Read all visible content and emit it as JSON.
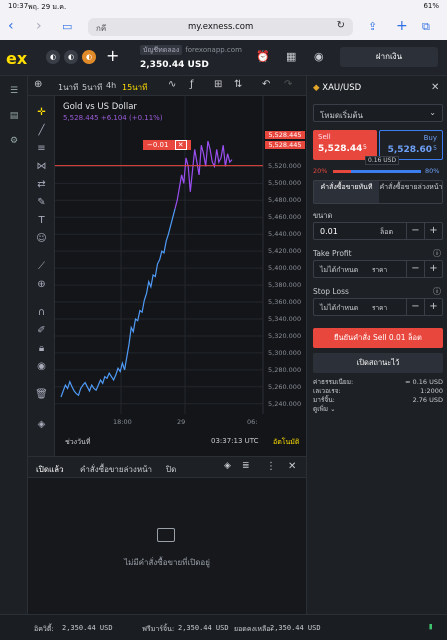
{
  "ios": {
    "time": "10:37",
    "date": "พฤ. 29 ม.ค.",
    "battery": "61%"
  },
  "safari": {
    "tab_text": "กคี",
    "url": "my.exness.com"
  },
  "header": {
    "logo": "ex",
    "account_badge": "บัญชีทดลอง",
    "server": "forexonapp.com",
    "balance": "2,350.44 USD",
    "deposit_label": "ฝากเงิน"
  },
  "toolbar": {
    "timeframes": [
      "1นาที",
      "5นาที",
      "4h",
      "15นาที"
    ],
    "active_timeframe": "15นาที"
  },
  "chart": {
    "title": "Gold vs US Dollar",
    "subtitle": "5,528.445  +6.104 (+0.11%)",
    "sell_line_label": "−0.01",
    "price_tags": [
      "5,528.445",
      "5,528.445"
    ],
    "footer_left": "ช่วงวันที่",
    "footer_time": "03:37:13 UTC",
    "footer_auto": "อัตโนมัติ"
  },
  "chart_data": {
    "type": "line",
    "title": "Gold vs US Dollar",
    "x_ticks": [
      "18:00",
      "29",
      "06:"
    ],
    "y_ticks": [
      5240,
      5260,
      5280,
      5300,
      5320,
      5340,
      5360,
      5380,
      5400,
      5420,
      5440,
      5460,
      5480,
      5500,
      5520
    ],
    "ylim": [
      5235,
      5570
    ],
    "series": [
      {
        "color": "#4f9bf7",
        "x": [
          0,
          2,
          4,
          6,
          8,
          10,
          12,
          14,
          16,
          18,
          20,
          22,
          24,
          26,
          28,
          30,
          32,
          34,
          36,
          38,
          40,
          42,
          44,
          46,
          48,
          50,
          52,
          54,
          56,
          58,
          60,
          62,
          64,
          66,
          68,
          70,
          72,
          74,
          76,
          78,
          80,
          82,
          84,
          86,
          88,
          90,
          92,
          94,
          96,
          98,
          100,
          102,
          104
        ],
        "y": [
          5248,
          5255,
          5262,
          5258,
          5266,
          5260,
          5255,
          5252,
          5250,
          5258,
          5262,
          5265,
          5260,
          5255,
          5262,
          5258,
          5256,
          5262,
          5268,
          5264,
          5272,
          5270,
          5276,
          5272,
          5268,
          5274,
          5282,
          5278,
          5288,
          5280,
          5295,
          5310,
          5330,
          5325,
          5340,
          5338,
          5350,
          5348,
          5362,
          5370,
          5384,
          5378,
          5392,
          5390,
          5405,
          5410,
          5420,
          5418,
          5432,
          5440,
          5450,
          5460,
          5470
        ]
      },
      {
        "color": "#9b4ff2",
        "x": [
          104,
          106,
          108,
          110,
          112,
          114,
          116,
          118,
          120,
          122,
          124,
          126,
          128,
          130,
          132,
          134,
          136,
          138,
          140,
          142,
          144,
          146,
          148,
          150,
          152,
          154,
          156
        ],
        "y": [
          5470,
          5480,
          5495,
          5510,
          5500,
          5530,
          5520,
          5490,
          5515,
          5540,
          5525,
          5510,
          5545,
          5535,
          5520,
          5550,
          5540,
          5525,
          5520,
          5540,
          5525,
          5530,
          5545,
          5520,
          5535,
          5525,
          5528
        ]
      }
    ]
  },
  "order": {
    "symbol": "XAU/USD",
    "mode": "โหมดเริ่มต้น",
    "sell_label": "Sell",
    "sell_price": "5,528.44",
    "sell_suffix": "5",
    "buy_label": "Buy",
    "buy_price": "5,528.60",
    "buy_suffix": "5",
    "spread": "0.16 USD",
    "sentiment_sell": "20%",
    "sentiment_buy": "80%",
    "tab_market": "คำสั่งซื้อขายทันที",
    "tab_pending": "คำสั่งซื้อขายล่วงหน้า",
    "volume_label": "ขนาด",
    "volume_value": "0.01",
    "volume_unit": "ล็อต",
    "tp_label": "Take Profit",
    "tp_value": "ไม่ได้กำหนด",
    "tp_unit": "ราคา",
    "sl_label": "Stop Loss",
    "sl_value": "ไม่ได้กำหนด",
    "sl_unit": "ราคา",
    "confirm_button": "ยืนยันคำสั่ง Sell 0.01 ล็อต",
    "more_button": "เปิดสถานะไว้",
    "fee_label": "ค่าธรรมเนียม:",
    "fee_value": "≈ 0.16 USD",
    "leverage_label": "เลเวอเรจ:",
    "leverage_value": "1:2000",
    "margin_label": "มาร์จิ้น:",
    "margin_value": "2.76 USD",
    "more_info": "ดูเพิ่ม"
  },
  "positions": {
    "tabs": [
      "เปิดแล้ว",
      "คำสั่งซื้อขายล่วงหน้า",
      "ปิด"
    ],
    "empty_text": "ไม่มีคำสั่งซื้อขายที่เปิดอยู่"
  },
  "bottom": {
    "equity_label": "อิควิตี้:",
    "equity_value": "2,350.44 USD",
    "free_margin_label": "ฟรีมาร์จิ้น:",
    "free_margin_value": "2,350.44 USD",
    "balance_label": "ยอดคงเหลือ:",
    "balance_value": "2,350.44 USD"
  }
}
